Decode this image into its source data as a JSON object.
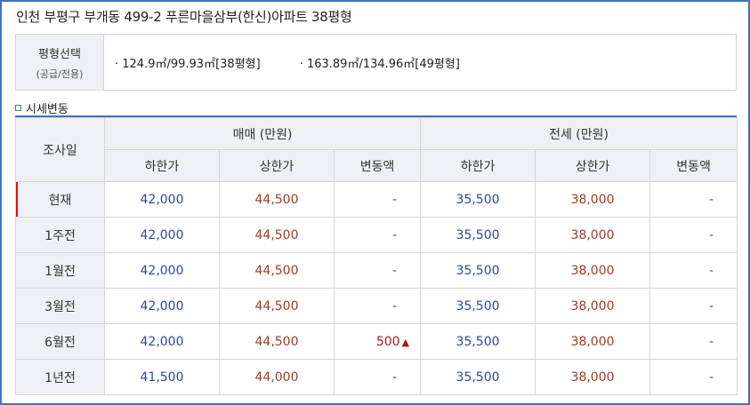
{
  "title": "인천 부평구 부개동 499-2 푸른마을삼부(한신)아파트 38평형",
  "size_select": {
    "label": "평형선택",
    "sublabel": "(공급/전용)",
    "options": [
      "· 124.9㎡/99.93㎡[38평형]",
      "· 163.89㎡/134.96㎡[49평형]"
    ]
  },
  "section_title": "시세변동",
  "table": {
    "date_header": "조사일",
    "group_sale": "매매 (만원)",
    "group_jeonse": "전세 (만원)",
    "sub_headers": [
      "하한가",
      "상한가",
      "변동액",
      "하한가",
      "상한가",
      "변동액"
    ],
    "rows": [
      {
        "date": "현재",
        "sale_low": "42,000",
        "sale_high": "44,500",
        "sale_change": "-",
        "jeonse_low": "35,500",
        "jeonse_high": "38,000",
        "jeonse_change": "-"
      },
      {
        "date": "1주전",
        "sale_low": "42,000",
        "sale_high": "44,500",
        "sale_change": "-",
        "jeonse_low": "35,500",
        "jeonse_high": "38,000",
        "jeonse_change": "-"
      },
      {
        "date": "1월전",
        "sale_low": "42,000",
        "sale_high": "44,500",
        "sale_change": "-",
        "jeonse_low": "35,500",
        "jeonse_high": "38,000",
        "jeonse_change": "-"
      },
      {
        "date": "3월전",
        "sale_low": "42,000",
        "sale_high": "44,500",
        "sale_change": "-",
        "jeonse_low": "35,500",
        "jeonse_high": "38,000",
        "jeonse_change": "-"
      },
      {
        "date": "6월전",
        "sale_low": "42,000",
        "sale_high": "44,500",
        "sale_change": "500",
        "sale_change_dir": "up",
        "jeonse_low": "35,500",
        "jeonse_high": "38,000",
        "jeonse_change": "-"
      },
      {
        "date": "1년전",
        "sale_low": "41,500",
        "sale_high": "44,000",
        "sale_change": "-",
        "jeonse_low": "35,500",
        "jeonse_high": "38,000",
        "jeonse_change": "-"
      }
    ]
  },
  "colors": {
    "accent": "#3c74b8",
    "low_price": "#2c4a9a",
    "high_price": "#9a3f2a",
    "up_arrow": "#b01010"
  }
}
